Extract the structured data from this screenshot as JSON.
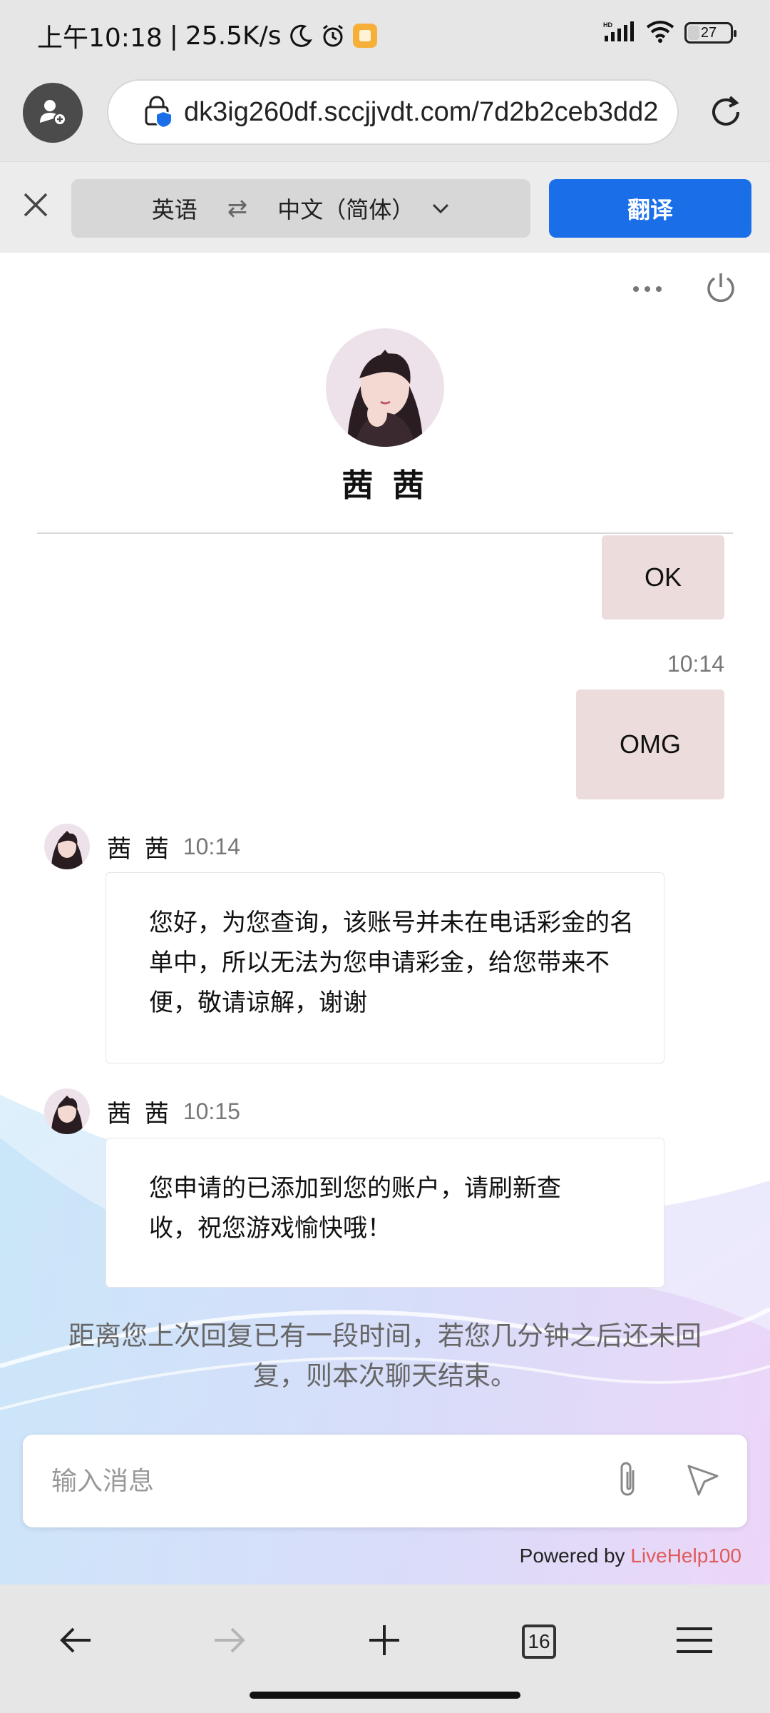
{
  "status_bar": {
    "time": "上午10:18",
    "net_speed": "25.5K/s",
    "battery": "27",
    "battery_level": 0.27,
    "icons": [
      "moon-icon",
      "alarm-icon",
      "notification-app-icon",
      "hd-signal-icon",
      "wifi-icon",
      "battery-icon"
    ]
  },
  "browser": {
    "url": "dk3ig260df.sccjjvdt.com/7d2b2ceb3dd2",
    "icons": [
      "add-profile-icon",
      "secure-lock-icon",
      "reload-icon"
    ]
  },
  "translate_bar": {
    "source_lang": "英语",
    "swap_symbol": "⇄",
    "target_lang": "中文（简体）",
    "translate_button": "翻译"
  },
  "chat": {
    "agent_name": "茜 茜",
    "messages_out": [
      {
        "text": "OK"
      },
      {
        "time": "10:14",
        "text": "OMG"
      }
    ],
    "messages_in": [
      {
        "name": "茜 茜",
        "time": "10:14",
        "text": "您好，为您查询，该账号并未在电话彩金的名单中，所以无法为您申请彩金，给您带来不便，敬请谅解，谢谢"
      },
      {
        "name": "茜 茜",
        "time": "10:15",
        "text": "您申请的已添加到您的账户，请刷新查收，祝您游戏愉快哦！"
      }
    ],
    "idle_note": "距离您上次回复已有一段时间，若您几分钟之后还未回复，则本次聊天结束。",
    "input_placeholder": "输入消息",
    "powered_by": "Powered by",
    "powered_brand": "LiveHelp100",
    "brand_color": "#e05a5a",
    "outgoing_bubble_color": "#ecdcdc"
  },
  "bottom_nav": {
    "tab_count": "16",
    "icons": [
      "back-icon",
      "forward-icon",
      "new-tab-icon",
      "tab-count-icon",
      "menu-icon"
    ]
  }
}
